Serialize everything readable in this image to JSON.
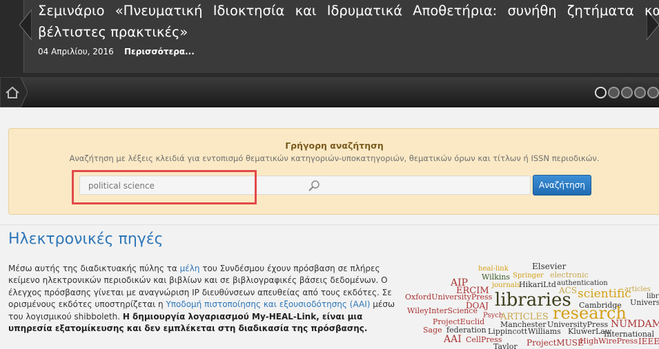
{
  "slider": {
    "title": "Σεμινάριο «Πνευματική Ιδιοκτησία και Ιδρυματικά Αποθετήρια: συνήθη ζητήματα και βέλτιστες πρακτικές»",
    "date": "04 Απριλίου, 2016",
    "more": "Περισσότερα..."
  },
  "quick_search": {
    "title": "Γρήγορη αναζήτηση",
    "description": "Αναζήτηση με λέξεις κλειδιά για εντοπισμό θεματικών κατηγοριών-υποκατηγοριών, θεματικών όρων και τίτλων ή ISSN περιοδικών.",
    "placeholder": "political science",
    "button": "Αναζήτηση"
  },
  "content": {
    "title": "Ηλεκτρονικές πηγές",
    "p1_a": "Μέσω αυτής της διαδικτυακής πύλης τα ",
    "p1_link": "μέλη",
    "p1_b": " του Συνδέσμου έχουν πρόσβαση σε πλήρες κείμενο ηλεκτρονικών περιοδικών και βιβλίων και σε βιβλιογραφικές βάσεις δεδομένων. Ο έλεγχος πρόσβασης γίνεται με αναγνώριση IP διευθύνσεων απευθείας από τους εκδότες. Σε ορισμένους εκδότες υποστηρίζεται η ",
    "p1_link2": "Υποδομή πιστοποίησης και εξουσιοδότησης (AAI)",
    "p1_c": " μέσω του λογισμικού shibboleth. ",
    "p1_bold": "Η δημιουργία λογαριασμού My-HEAL-Link, είναι μια υπηρεσία εξατομίκευσης και δεν εμπλέκεται στη διαδικασία της πρόσβασης."
  },
  "wordcloud": {
    "words": [
      "heal-link",
      "Elsevier",
      "electronic",
      "Wilkins",
      "Springer",
      "AIP",
      "journals",
      "HikariLtd",
      "authentication",
      "ERCIM",
      "ACS",
      "scientific",
      "library",
      "OxfordUniversityPress",
      "libraries",
      "Cambridge",
      "articles",
      "Univers",
      "DOAJ",
      "WileyInterScience",
      "research",
      "Psych",
      "ProjectEuclid",
      "ARTICLES",
      "Manchester",
      "UniversityPress",
      "NUMDAM",
      "Sage",
      "federation",
      "Lippincott",
      "Williams",
      "KluwerLaw",
      "International",
      "AAI",
      "CellPress",
      "ProjectMUSE",
      "HighWirePress",
      "IEEE",
      "Taylor"
    ]
  },
  "colors": {
    "accent": "#2f77b8",
    "highlight": "#e24a4a",
    "search_bg": "#fbe9c5"
  }
}
